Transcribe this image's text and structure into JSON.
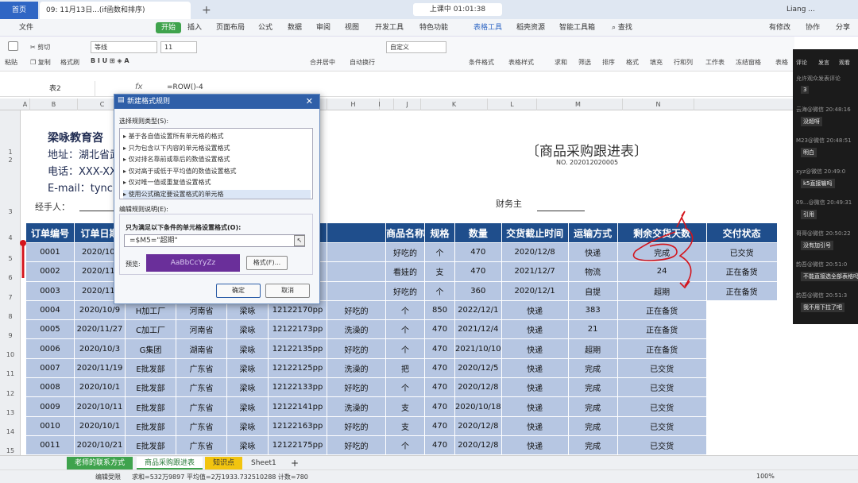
{
  "titlebar": {
    "home": "首页",
    "doc_tab": "09: 11月13日...(if函数和排序)",
    "new_tab": "+",
    "live": "上课中 01:01:38",
    "user": "Liang ..."
  },
  "menu": {
    "file": "文件",
    "start": "开始",
    "items": [
      "插入",
      "页面布局",
      "公式",
      "数据",
      "审阅",
      "视图",
      "开发工具",
      "特色功能",
      "表格工具",
      "稻壳资源",
      "智能工具箱"
    ],
    "search": "查找",
    "right": [
      "有修改",
      "协作",
      "分享"
    ]
  },
  "toolbar": {
    "cut": "剪切",
    "copy": "复制",
    "paste": "粘贴",
    "format_painter": "格式刷",
    "font": "等线",
    "size": "11",
    "merge": "合并居中",
    "wrap": "自动换行",
    "numfmt": "自定义",
    "cond": "条件格式",
    "tablestyle": "表格样式",
    "sum": "求和",
    "filter": "筛选",
    "sort": "排序",
    "format": "格式",
    "fill": "填充",
    "rowcol": "行和列",
    "sheet": "工作表",
    "freeze": "冻结窗格",
    "more": "表格"
  },
  "formula_bar": {
    "name_box": "表2",
    "fx": "fx",
    "formula": "=ROW()-4"
  },
  "columns": [
    "A",
    "B",
    "C",
    "D",
    "E",
    "F",
    "G",
    "H",
    "I",
    "J",
    "K",
    "L",
    "M",
    "N"
  ],
  "rows": [
    "1",
    "2",
    "3",
    "4",
    "5",
    "6",
    "7",
    "8",
    "9",
    "10",
    "11",
    "12",
    "13",
    "14",
    "15"
  ],
  "company": {
    "name": "梁咏教育咨",
    "address": "地址：湖北省武",
    "phone": "电话：XXX-XXX",
    "email": "E-mail：tyncre"
  },
  "report": {
    "title": "〔商品采购跟进表〕",
    "doc_no": "NO. 202012020005",
    "handler_label": "经手人：",
    "finance_label": "财务主"
  },
  "table": {
    "headers": [
      "订单编号",
      "订单日期",
      "",
      "",
      "",
      "",
      "",
      "商品名称",
      "规格",
      "数量",
      "交货截止时间",
      "运输方式",
      "剩余交货天数",
      "交付状态"
    ],
    "rows": [
      [
        "0001",
        "2020/10/",
        "",
        "",
        "",
        "",
        "",
        "好吃的",
        "个",
        "470",
        "2020/12/8",
        "快递",
        "完成",
        "已交货"
      ],
      [
        "0002",
        "2020/11/",
        "",
        "",
        "",
        "",
        "",
        "看娃的",
        "支",
        "470",
        "2021/12/7",
        "物流",
        "24",
        "正在备货"
      ],
      [
        "0003",
        "2020/11/",
        "",
        "",
        "",
        "",
        "",
        "好吃的",
        "个",
        "360",
        "2020/12/1",
        "自提",
        "超期",
        "正在备货"
      ],
      [
        "0004",
        "2020/10/9",
        "H加工厂",
        "河南省",
        "梁咏",
        "12122170pp",
        "好吃的",
        "个",
        "850",
        "2022/12/1",
        "快递",
        "383",
        "正在备货"
      ],
      [
        "0005",
        "2020/11/27",
        "C加工厂",
        "河南省",
        "梁咏",
        "12122173pp",
        "洗澡的",
        "个",
        "470",
        "2021/12/4",
        "快递",
        "21",
        "正在备货"
      ],
      [
        "0006",
        "2020/10/3",
        "G集团",
        "湖南省",
        "梁咏",
        "12122135pp",
        "好吃的",
        "个",
        "470",
        "2021/10/10",
        "快递",
        "超期",
        "正在备货"
      ],
      [
        "0007",
        "2020/11/19",
        "E批发部",
        "广东省",
        "梁咏",
        "12122125pp",
        "洗澡的",
        "把",
        "470",
        "2020/12/5",
        "快递",
        "完成",
        "已交货"
      ],
      [
        "0008",
        "2020/10/1",
        "E批发部",
        "广东省",
        "梁咏",
        "12122133pp",
        "好吃的",
        "个",
        "470",
        "2020/12/8",
        "快递",
        "完成",
        "已交货"
      ],
      [
        "0009",
        "2020/10/11",
        "E批发部",
        "广东省",
        "梁咏",
        "12122141pp",
        "洗澡的",
        "支",
        "470",
        "2020/10/18",
        "快递",
        "完成",
        "已交货"
      ],
      [
        "0010",
        "2020/10/1",
        "E批发部",
        "广东省",
        "梁咏",
        "12122163pp",
        "好吃的",
        "支",
        "470",
        "2020/12/8",
        "快递",
        "完成",
        "已交货"
      ],
      [
        "0011",
        "2020/10/21",
        "E批发部",
        "广东省",
        "梁咏",
        "12122175pp",
        "好吃的",
        "个",
        "470",
        "2020/12/8",
        "快递",
        "完成",
        "已交货"
      ]
    ]
  },
  "sheet_tabs": [
    "老师的联系方式",
    "商品采购跟进表",
    "知识点",
    "Sheet1"
  ],
  "status": {
    "mode": "编辑受限",
    "stats": "求和=532万9897  平均值=2万1933.732510288  计数=780",
    "zoom": "100%"
  },
  "dialog": {
    "title": "新建格式规则",
    "select_type_label": "选择规则类型(S):",
    "rule_types": [
      "基于各自值设置所有单元格的格式",
      "只为包含以下内容的单元格设置格式",
      "仅对排名靠前或靠后的数值设置格式",
      "仅对高于或低于平均值的数值设置格式",
      "仅对唯一值或重复值设置格式",
      "使用公式确定要设置格式的单元格"
    ],
    "edit_label": "编辑规则说明(E):",
    "formula_label": "只为满足以下条件的单元格设置格式(O):",
    "condition": "=$M5=\"超期\"",
    "preview_label": "预览:",
    "preview_text": "AaBbCcYyZz",
    "format_button": "格式(F)...",
    "ok": "确定",
    "cancel": "取消"
  },
  "side_panel": {
    "tabs": [
      "评论",
      "发言",
      "观看"
    ],
    "messages": [
      {
        "meta": "允许观众发表评论",
        "text": "3"
      },
      {
        "meta": "云海@微信 20:48:16",
        "text": "没超呀"
      },
      {
        "meta": "M23@微信 20:48:51",
        "text": "明白"
      },
      {
        "meta": "xyz@微信 20:49:0",
        "text": "k5直接输吗"
      },
      {
        "meta": "09...@微信 20:49:31",
        "text": "引用"
      },
      {
        "meta": "哥哥@微信 20:50:22",
        "text": "没有加引号"
      },
      {
        "meta": "韵吾@微信 20:51:0",
        "text": "不能直接选全部表格吗"
      },
      {
        "meta": "韵吾@微信 20:51:3",
        "text": "我不用下拉了吧"
      }
    ]
  },
  "colors": {
    "header_bg": "#1f4e8c",
    "row_bg": "#b6c6e2",
    "dialog_title": "#2f5fa8",
    "preview_bg": "#6a2f9a",
    "annotation": "#d4141c"
  }
}
